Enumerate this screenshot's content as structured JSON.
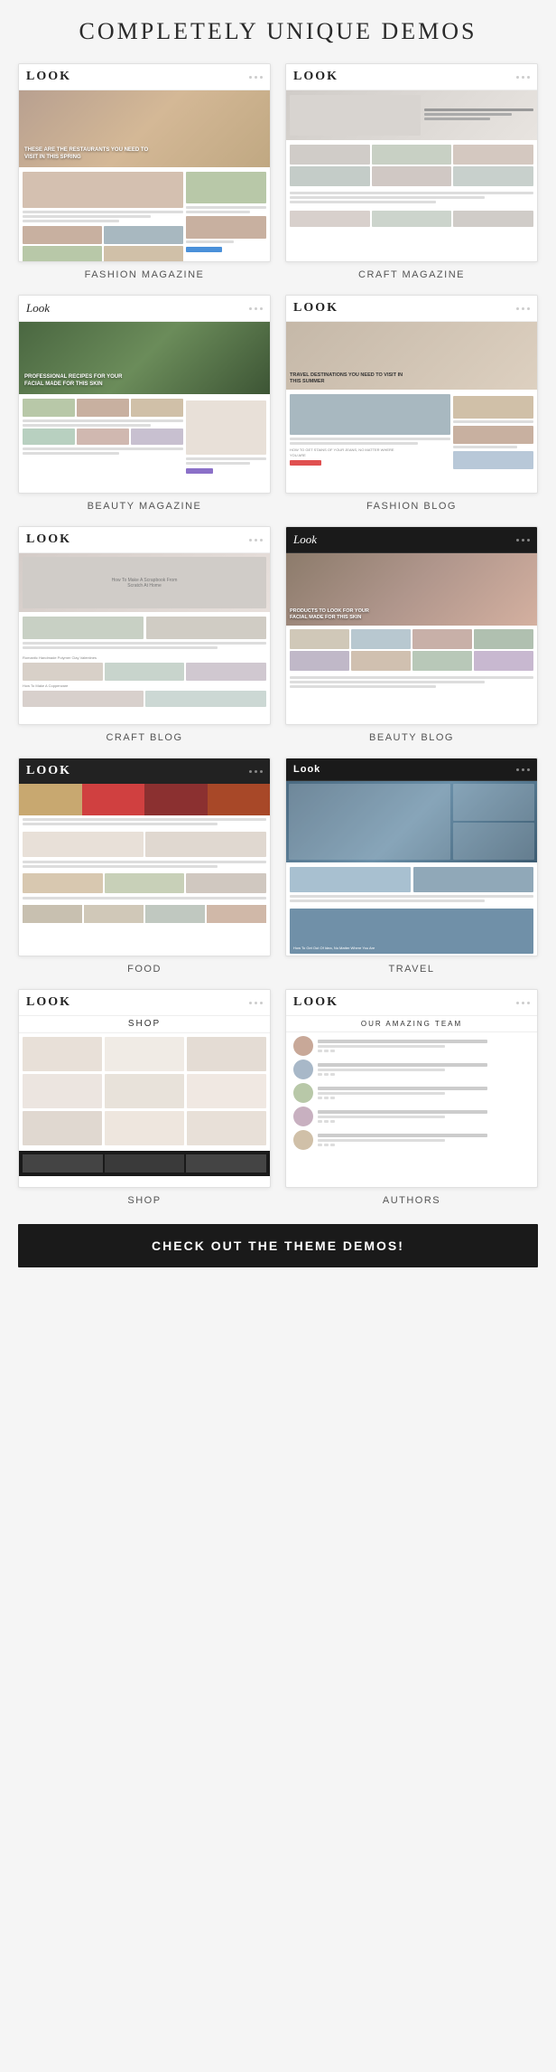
{
  "page": {
    "title": "COMPLETELY UNIQUE DEMOS",
    "cta_label": "CHECK OUT THE THEME DEMOS!"
  },
  "demos": [
    {
      "id": "fashion-magazine",
      "label": "FASHION MAGAZINE",
      "logo": "LOOK",
      "type": "fashion-magazine"
    },
    {
      "id": "craft-magazine",
      "label": "CRAFT MAGAZINE",
      "logo": "LOOK",
      "type": "craft-magazine"
    },
    {
      "id": "beauty-magazine",
      "label": "BEAUTY MAGAZINE",
      "logo": "Look",
      "type": "beauty-magazine"
    },
    {
      "id": "fashion-blog",
      "label": "FASHION BLOG",
      "logo": "LOOK",
      "type": "fashion-blog"
    },
    {
      "id": "craft-blog",
      "label": "CRAFT BLOG",
      "logo": "LOOK",
      "type": "craft-blog"
    },
    {
      "id": "beauty-blog",
      "label": "BEAUTY BLOG",
      "logo": "Look",
      "type": "beauty-blog"
    },
    {
      "id": "food",
      "label": "FOOD",
      "logo": "LOOK",
      "type": "food"
    },
    {
      "id": "travel",
      "label": "TRAVEL",
      "logo": "LOOK",
      "type": "travel"
    },
    {
      "id": "shop",
      "label": "SHOP",
      "logo": "LOOK",
      "type": "shop"
    },
    {
      "id": "authors",
      "label": "AUTHORS",
      "logo": "LOOK",
      "type": "authors"
    }
  ]
}
